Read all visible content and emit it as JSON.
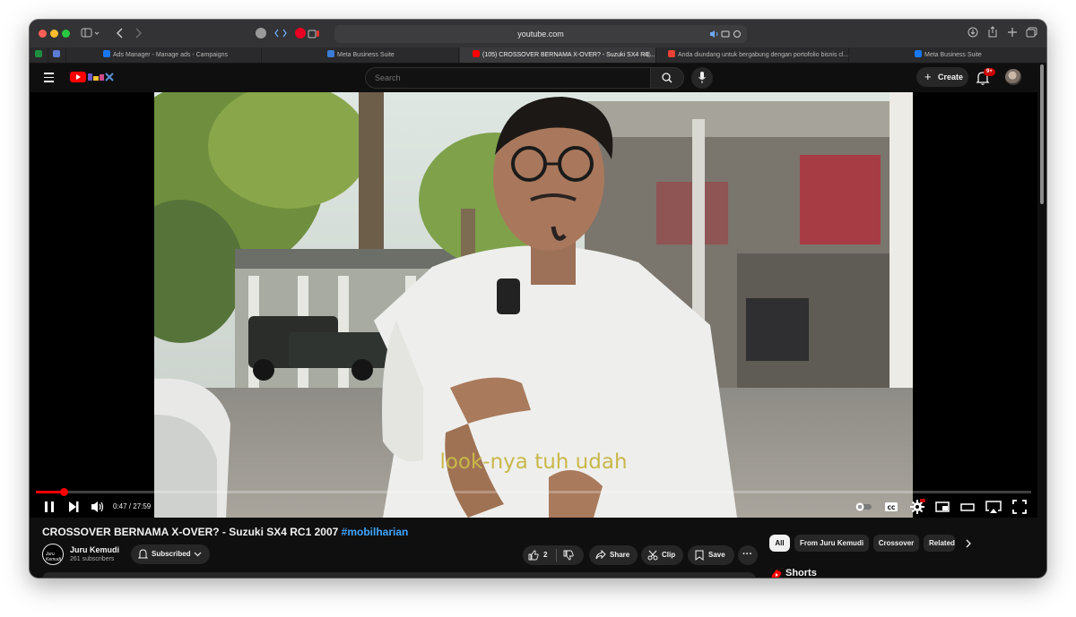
{
  "browser": {
    "address": "youtube.com",
    "tabs": [
      {
        "label": "",
        "favicon_color": "#1e8e3e"
      },
      {
        "label": "",
        "favicon_color": "#5b7bd5"
      },
      {
        "label": "Ads Manager - Manage ads - Campaigns",
        "favicon_color": "#1877f2"
      },
      {
        "label": "Meta Business Suite",
        "favicon_color": "#3a7bd5"
      },
      {
        "label": "(105) CROSSOVER BERNAMA X-OVER? - Suzuki SX4 RC...",
        "favicon_color": "#ff0000"
      },
      {
        "label": "Anda diundang untuk bergabung dengan portofolio bisnis cl...",
        "favicon_color": "#ea4335"
      },
      {
        "label": "Meta Business Suite",
        "favicon_color": "#1877f2"
      }
    ]
  },
  "header": {
    "search_placeholder": "Search",
    "create_label": "Create",
    "notification_badge": "9+"
  },
  "player": {
    "subtitle": "look-nya tuh udah",
    "time_display": "0:47 / 27:59",
    "progress_fraction": 0.028
  },
  "video": {
    "title": "CROSSOVER BERNAMA X-OVER? - Suzuki SX4 RC1 2007",
    "hashtag": "#mobilharian",
    "channel_name": "Juru Kemudi",
    "channel_subs": "261 subscribers",
    "channel_avatar_text": "Juru Kemudi",
    "subscribed_label": "Subscribed",
    "like_count": "2",
    "share_label": "Share",
    "clip_label": "Clip",
    "save_label": "Save"
  },
  "sidebar": {
    "chips": [
      "All",
      "From Juru Kemudi",
      "Crossover",
      "Related"
    ],
    "shorts_label": "Shorts"
  },
  "colors": {
    "accent": "#ff0000",
    "link": "#3ea6ff",
    "background": "#0f0f0f"
  }
}
